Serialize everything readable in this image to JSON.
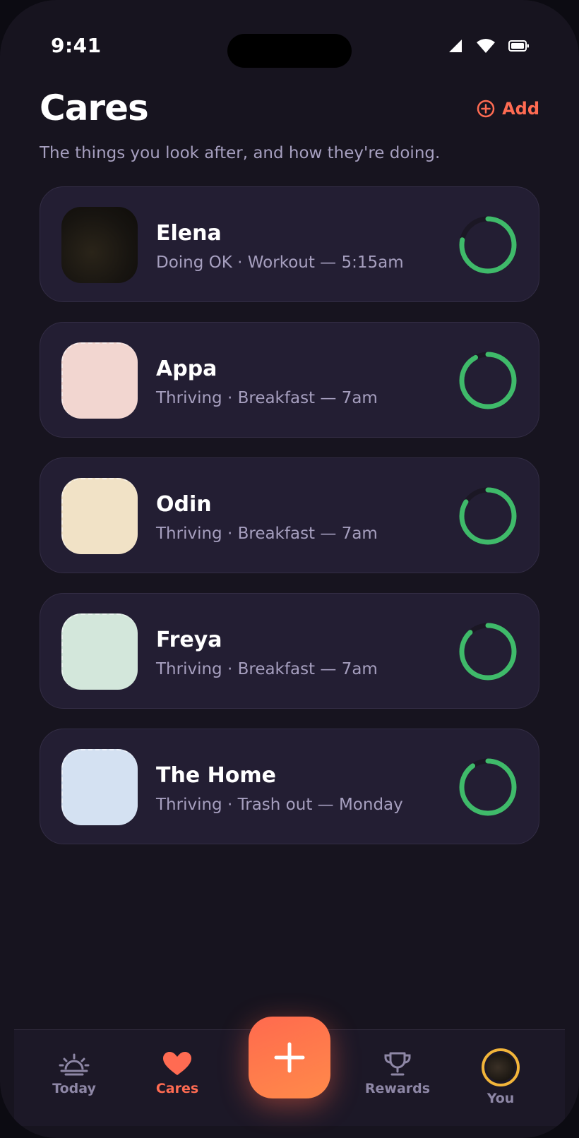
{
  "status_bar": {
    "time": "9:41"
  },
  "header": {
    "title": "Cares",
    "add_label": "Add",
    "subtitle": "The things you look after, and how they're doing."
  },
  "cares": [
    {
      "name": "Elena",
      "status": "Doing OK · Workout — 5:15am",
      "avatar": "photo",
      "progress": 0.78,
      "ring_color": "#3fba6a"
    },
    {
      "name": "Appa",
      "status": "Thriving · Breakfast — 7am",
      "avatar": "#f2d6d0",
      "progress": 0.92,
      "ring_color": "#3fba6a"
    },
    {
      "name": "Odin",
      "status": "Thriving · Breakfast — 7am",
      "avatar": "#f1e2c6",
      "progress": 0.84,
      "ring_color": "#3fba6a"
    },
    {
      "name": "Freya",
      "status": "Thriving · Breakfast — 7am",
      "avatar": "#d3e7db",
      "progress": 0.88,
      "ring_color": "#3fba6a"
    },
    {
      "name": "The Home",
      "status": "Thriving · Trash out — Monday",
      "avatar": "#d4e1f2",
      "progress": 0.9,
      "ring_color": "#3fba6a"
    }
  ],
  "tabs": {
    "today": "Today",
    "cares": "Cares",
    "rewards": "Rewards",
    "you": "You"
  },
  "colors": {
    "accent": "#ff6b52",
    "ring_track": "#1b1724",
    "muted": "#8e87a6"
  }
}
